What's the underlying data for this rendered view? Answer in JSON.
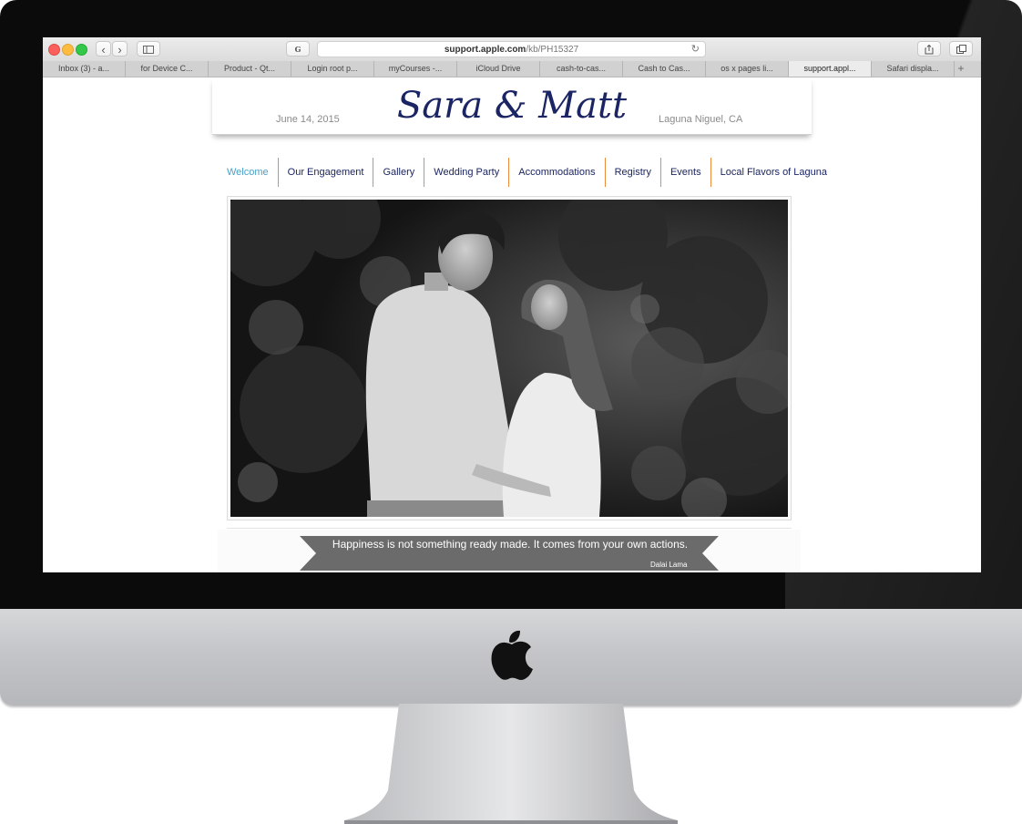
{
  "browser": {
    "url_host": "support.apple.com",
    "url_path": "/kb/PH15327",
    "favicon_letter": "G",
    "tabs": [
      "Inbox (3) - a...",
      "for Device C...",
      "Product - Qt...",
      "Login root p...",
      "myCourses -...",
      "iCloud Drive",
      "cash-to-cas...",
      "Cash to Cas...",
      "os x pages li...",
      "support.appl...",
      "Safari displa..."
    ],
    "active_tab_index": 9,
    "new_tab_symbol": "+"
  },
  "site": {
    "date": "June 14, 2015",
    "title": "Sara & Matt",
    "location": "Laguna Niguel, CA",
    "title_color": "#1b2563",
    "nav_accent_color": "#ec8b3b",
    "nav": [
      {
        "label": "Welcome",
        "active": true
      },
      {
        "label": "Our Engagement"
      },
      {
        "label": "Gallery"
      },
      {
        "label": "Wedding Party"
      },
      {
        "label": "Accommodations"
      },
      {
        "label": "Registry"
      },
      {
        "label": "Events"
      },
      {
        "label": "Local Flavors of Laguna"
      }
    ],
    "quote": {
      "text": "Happiness is not something ready made. It comes from your own actions.",
      "author": "Dalai Lama"
    }
  }
}
